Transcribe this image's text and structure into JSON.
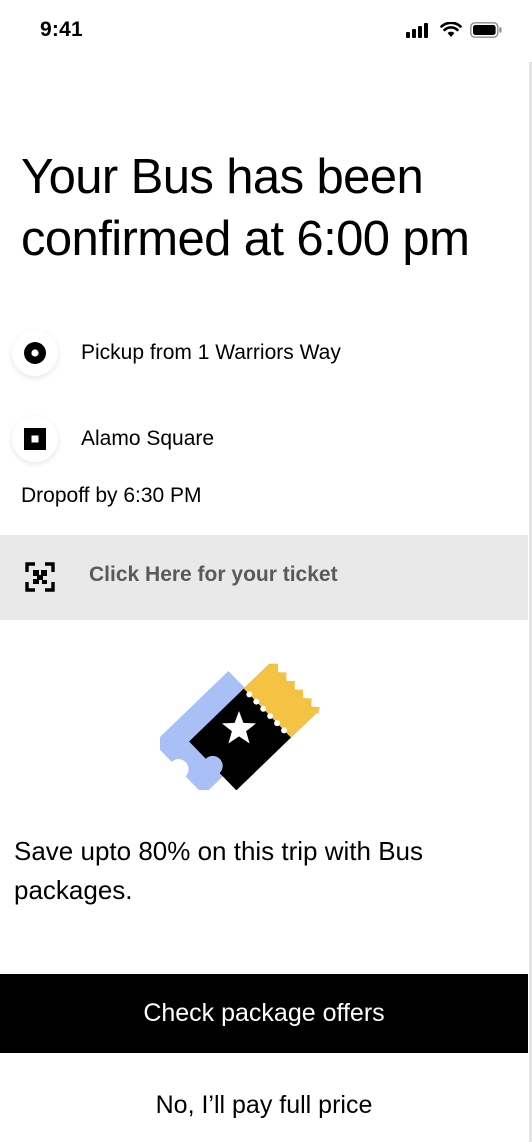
{
  "status_bar": {
    "time": "9:41",
    "icons": [
      "cellular-signal-icon",
      "wifi-icon",
      "battery-icon"
    ]
  },
  "title": "Your Bus has been confirmed at 6:00 pm",
  "pickup": {
    "icon": "pickup-dot-icon",
    "label": "Pickup from 1 Warriors Way"
  },
  "destination": {
    "icon": "dropoff-square-icon",
    "label": "Alamo Square"
  },
  "dropoff_time": "Dropoff by 6:30 PM",
  "ticket_link": {
    "icon": "qr-scan-icon",
    "label": "Click Here for your ticket"
  },
  "illustration": {
    "icon": "tickets-illustration",
    "colors": [
      "#a8c0f5",
      "#000000",
      "#f6c244",
      "#ffffff"
    ]
  },
  "promo_text": "Save upto 80% on this trip with Bus packages.",
  "actions": {
    "primary_label": "Check package offers",
    "secondary_label": "No, I’ll pay full price"
  },
  "colors": {
    "background": "#ffffff",
    "primary_button": "#000000",
    "ticket_row_bg": "#e9e9e9",
    "ticket_label": "#5a5a5a"
  }
}
